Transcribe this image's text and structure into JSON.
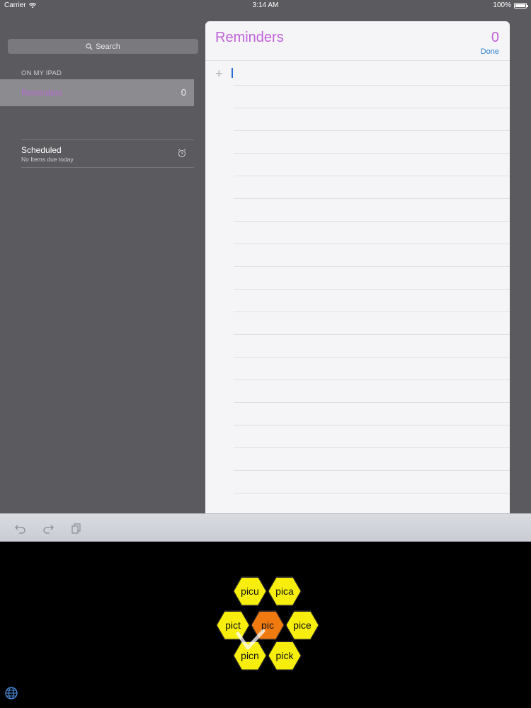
{
  "status_bar": {
    "carrier": "Carrier",
    "time": "3:14 AM",
    "battery_text": "100%",
    "battery_level": 1.0
  },
  "sidebar": {
    "search_label": "Search",
    "section_header": "ON MY IPAD",
    "selected_list": {
      "label": "Reminders",
      "count": "0",
      "color": "#b968d6"
    },
    "scheduled": {
      "title": "Scheduled",
      "subtitle": "No Items due today"
    }
  },
  "note": {
    "title": "Reminders",
    "count": "0",
    "done_label": "Done",
    "accent": "#c062dc",
    "done_color": "#2d83d6"
  },
  "toolbar": {
    "icons": [
      "undo-icon",
      "redo-icon",
      "paste-icon"
    ]
  },
  "keyboard": {
    "center": "pic",
    "suggestions": {
      "top_left": "picu",
      "top_right": "pica",
      "left": "pict",
      "right": "pice",
      "bottom_left": "picn",
      "bottom_right": "pick"
    },
    "center_color": "#f07a10",
    "suggestion_color": "#f7ee0d"
  }
}
